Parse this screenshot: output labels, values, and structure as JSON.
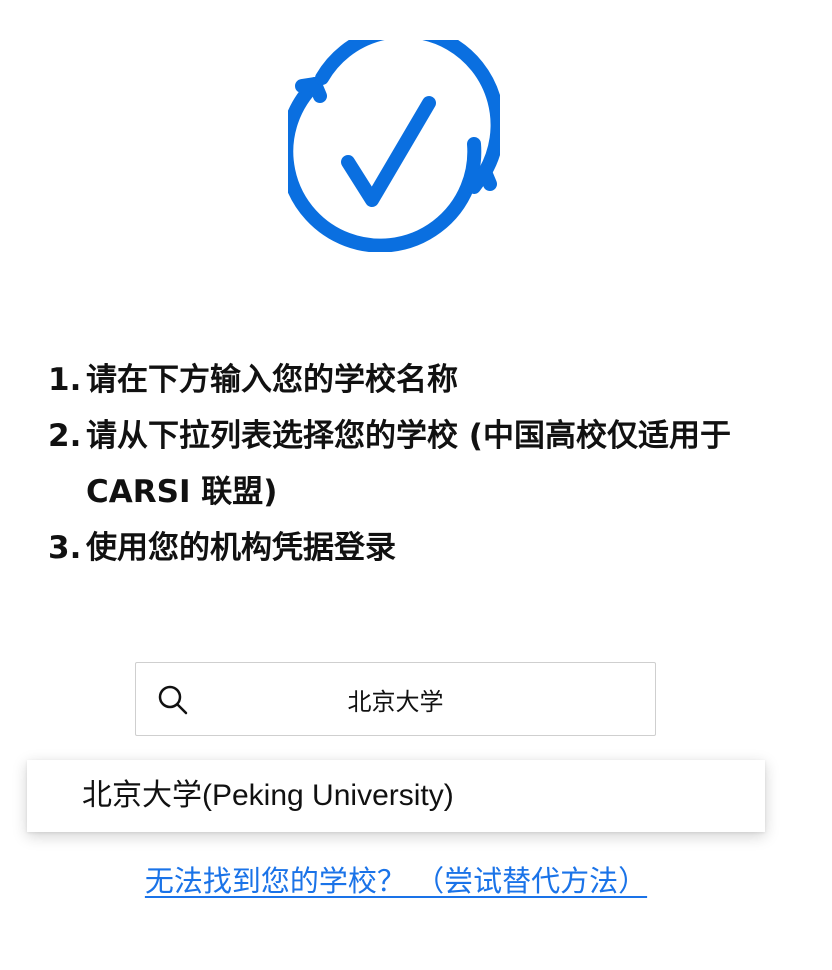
{
  "logo": {
    "icon": "circular-check-icon",
    "color": "#0a6fe0"
  },
  "instructions": [
    {
      "num": "1.",
      "text": "请在下方输入您的学校名称"
    },
    {
      "num": "2.",
      "text": "请从下拉列表选择您的学校 (中国高校仅适用于 CARSI 联盟)"
    },
    {
      "num": "3.",
      "text": "使用您的机构凭据登录"
    }
  ],
  "search": {
    "icon": "search-icon",
    "value": "北京大学"
  },
  "dropdown": {
    "items": [
      {
        "label": "北京大学(Peking University)"
      }
    ]
  },
  "alt_link": {
    "label": "无法找到您的学校？ （尝试替代方法）",
    "color": "#1a73e8"
  }
}
